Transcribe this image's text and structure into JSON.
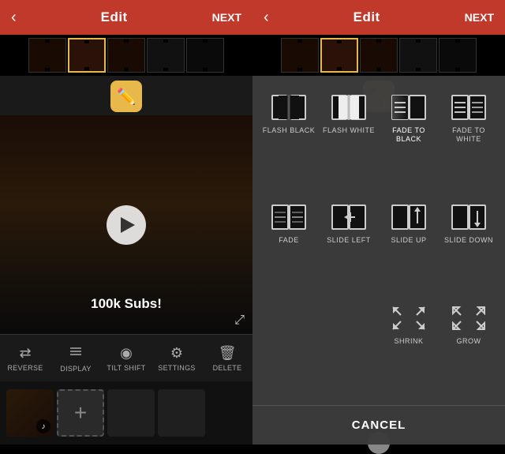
{
  "left": {
    "topBar": {
      "backLabel": "‹",
      "title": "Edit",
      "nextLabel": "NEXT"
    },
    "videoBanner": "100k Subs!",
    "toolbar": [
      {
        "id": "reverse",
        "icon": "⇄",
        "label": "REVERSE"
      },
      {
        "id": "display",
        "icon": "☰",
        "label": "DISPLAY"
      },
      {
        "id": "tiltshift",
        "icon": "◉",
        "label": "TILT SHIFT"
      },
      {
        "id": "settings",
        "icon": "⚙",
        "label": "SETTINGS"
      },
      {
        "id": "delete",
        "icon": "🗑",
        "label": "DELETE"
      }
    ]
  },
  "right": {
    "topBar": {
      "backLabel": "‹",
      "title": "Edit",
      "nextLabel": "NEXT"
    },
    "transitions": [
      {
        "id": "flash-black",
        "label": "FLASH\nBLACK",
        "type": "flash-black"
      },
      {
        "id": "flash-white",
        "label": "FLASH\nWHITE",
        "type": "flash-white"
      },
      {
        "id": "fade-to-black",
        "label": "FADE TO\nBLACK",
        "type": "fade-to-black",
        "selected": true
      },
      {
        "id": "fade-to-white",
        "label": "FADE TO\nWHITE",
        "type": "fade-to-white"
      },
      {
        "id": "fade",
        "label": "FADE",
        "type": "fade"
      },
      {
        "id": "slide-left",
        "label": "SLIDE\nLEFT",
        "type": "slide-left"
      },
      {
        "id": "slide-up",
        "label": "SLIDE\nUP",
        "type": "slide-up"
      },
      {
        "id": "slide-down",
        "label": "SLIDE\nDOWN",
        "type": "slide-down"
      },
      {
        "id": "shrink",
        "label": "SHRINK",
        "type": "shrink"
      },
      {
        "id": "grow",
        "label": "GROW",
        "type": "grow"
      }
    ],
    "cancelLabel": "CANCEL"
  }
}
